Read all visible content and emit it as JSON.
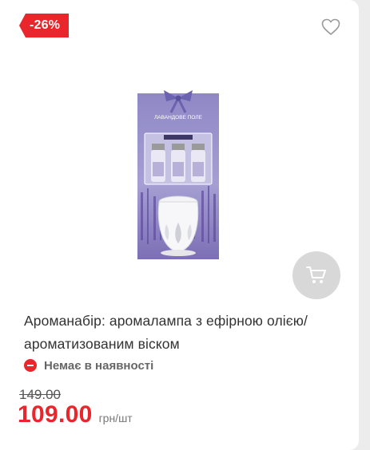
{
  "product": {
    "discount_badge": "-26%",
    "title": "Ароманабір: аромалампа з ефірною олією/ ароматизованим віском",
    "availability": "Немає в наявності",
    "old_price": "149.00",
    "price": "109.00",
    "unit": "грн/шт",
    "package_label": "ЛАВАНДОВЕ ПОЛЕ"
  },
  "icons": {
    "favorite": "heart-outline-icon",
    "cart": "cart-icon",
    "availability": "minus-circle-icon"
  },
  "colors": {
    "accent_red": "#e8262b",
    "cart_button_bg": "#d8d8d8",
    "package_purple": "#8a83c0"
  }
}
